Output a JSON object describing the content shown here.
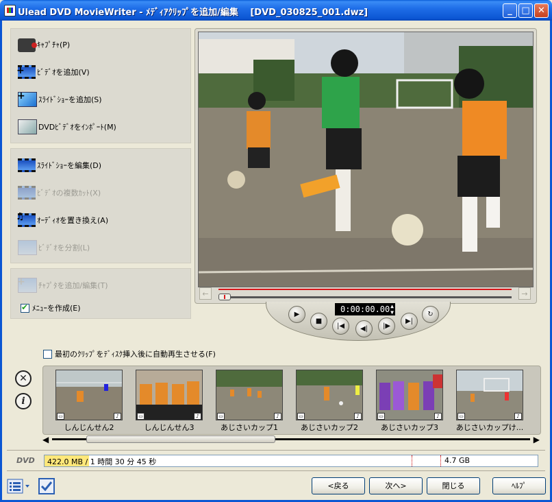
{
  "window": {
    "title": "Ulead DVD MovieWriter - ﾒﾃﾞｨｱｸﾘｯﾌﾟを追加/編集　 [DVD_030825_001.dwz]",
    "minimize_icon": "minimize-icon",
    "maximize_icon": "maximize-icon",
    "close_icon": "close-icon"
  },
  "left_panel": {
    "group1": [
      {
        "label": "ｷｬﾌﾟﾁｬ(P)",
        "icon": "camcorder-icon",
        "enabled": true
      },
      {
        "label": "ﾋﾞﾃﾞｵを追加(V)",
        "icon": "add-video-icon",
        "enabled": true
      },
      {
        "label": "ｽﾗｲﾄﾞｼｮｰを追加(S)",
        "icon": "add-slideshow-icon",
        "enabled": true
      },
      {
        "label": "DVDﾋﾞﾃﾞｵをｲﾝﾎﾟｰﾄ(M)",
        "icon": "import-dvd-icon",
        "enabled": true
      }
    ],
    "group2": [
      {
        "label": "ｽﾗｲﾄﾞｼｮｰを編集(D)",
        "icon": "edit-slideshow-icon",
        "enabled": true
      },
      {
        "label": "ﾋﾞﾃﾞｵの複数ｶｯﾄ(X)",
        "icon": "multi-trim-icon",
        "enabled": false
      },
      {
        "label": "ｵｰﾃﾞｨｵを置き換え(A)",
        "icon": "replace-audio-icon",
        "enabled": true
      },
      {
        "label": "ﾋﾞﾃﾞｵを分割(L)",
        "icon": "split-video-icon",
        "enabled": false
      }
    ],
    "group3": {
      "chapter_label": "ﾁｬﾌﾟﾀを追加/編集(T)",
      "menu_checkbox_label": "ﾒﾆｭｰを作成(E)",
      "menu_checked": true
    }
  },
  "player": {
    "timecode": "0:00:00.00"
  },
  "autoplay": {
    "label": "最初のｸﾘｯﾌﾟをﾃﾞｨｽｸ挿入後に自動再生させる(F)",
    "checked": false
  },
  "clips": [
    {
      "name": "しんじんせん2"
    },
    {
      "name": "しんじんせん3"
    },
    {
      "name": "あじさいカップ1"
    },
    {
      "name": "あじさいカップ2"
    },
    {
      "name": "あじさいカップ3"
    },
    {
      "name": "あじさいカップけ..."
    }
  ],
  "capacity": {
    "label": "DVD",
    "used_size": "422.0 MB",
    "duration": "/ 1 時間 30 分 45 秒",
    "total": "4.7 GB",
    "used_fraction": 0.09
  },
  "buttons": {
    "back": "<戻る",
    "next": "次へ>",
    "close": "閉じる",
    "help": "ﾍﾙﾌﾟ"
  },
  "colors": {
    "titlebar": "#0b56d3",
    "timeline_marker": "#d8171b",
    "capacity_fill": "#ffe87a"
  }
}
